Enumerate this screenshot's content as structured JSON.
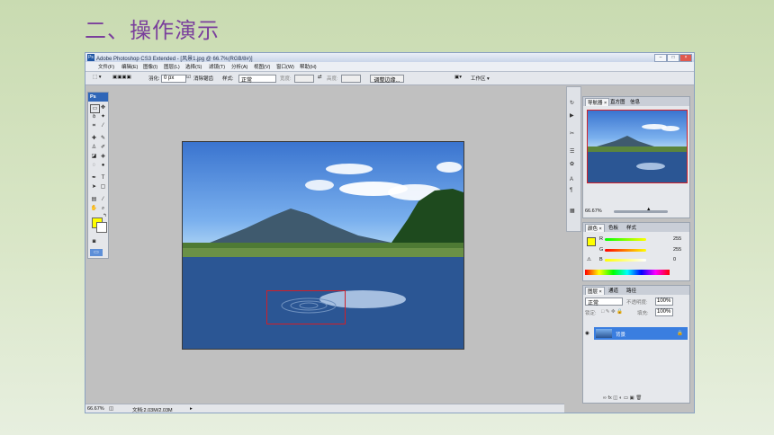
{
  "slide": {
    "title": "二、操作演示"
  },
  "window": {
    "title": "Adobe Photoshop CS3 Extended - [风景1.jpg @ 66.7%(RGB/8#)]",
    "logo": "Ps",
    "controls": [
      "–",
      "□",
      "×"
    ]
  },
  "menu": {
    "items": [
      "文件(F)",
      "编辑(E)",
      "图像(I)",
      "图层(L)",
      "选择(S)",
      "滤镜(T)",
      "分析(A)",
      "视图(V)",
      "窗口(W)",
      "帮助(H)"
    ]
  },
  "options": {
    "feather_label": "羽化:",
    "feather_value": "0 px",
    "antialias_label": "消除锯齿",
    "style_label": "样式:",
    "style_value": "正常",
    "width_label": "宽度:",
    "height_label": "高度:",
    "refine_button": "调整边缘...",
    "workspace_button": "工作区 ▾"
  },
  "toolbox": {
    "logo": "Ps",
    "fg_color": "#ffff00",
    "bg_color": "#ffffff"
  },
  "status": {
    "zoom": "66.67%",
    "doc": "文档:2.03M/2.03M"
  },
  "navigator": {
    "tabs": [
      "导航器 ×",
      "直方图",
      "信息"
    ],
    "zoom": "66.67%"
  },
  "color_panel": {
    "tabs": [
      "颜色 ×",
      "色板",
      "样式"
    ],
    "r_label": "R",
    "r_value": "255",
    "g_label": "G",
    "g_value": "255",
    "b_label": "B",
    "b_value": "0",
    "swatch": "#ffff00"
  },
  "layers_panel": {
    "tabs": [
      "图层 ×",
      "通道",
      "路径"
    ],
    "blend_mode": "正常",
    "opacity_label": "不透明度:",
    "opacity_value": "100%",
    "lock_label": "锁定:",
    "fill_label": "填充:",
    "fill_value": "100%",
    "layer_name": "背景"
  },
  "colors": {
    "selection": "#d11f28",
    "title": "#7a3f9c",
    "layer_active": "#3a7ee0"
  }
}
